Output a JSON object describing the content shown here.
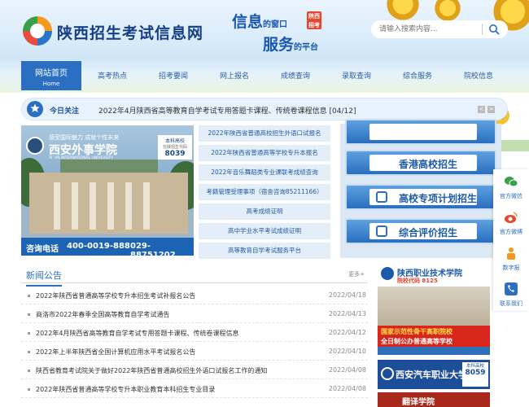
{
  "header": {
    "site_title": "陕西招生考试信息网",
    "slogan_line1": "信息",
    "slogan_line1_small": "的窗口",
    "slogan_line2": "服务",
    "slogan_line2_small": "的平台",
    "slogan_badge": "陕西招考",
    "search_placeholder": "请输入搜索内容..."
  },
  "nav": {
    "home_label": "网站首页",
    "home_sub": "Home",
    "items": [
      "高考热点",
      "招考要闻",
      "网上报名",
      "成绩查询",
      "录取查询",
      "综合服务",
      "院校信息"
    ]
  },
  "today": {
    "label": "今日关注",
    "headline": "2022年4月陕西省高等教育自学考试专用答题卡课程、传统卷课程信息  [04/12]",
    "prev": "<",
    "next": ">"
  },
  "banner": {
    "slogan": "感受国际魅力  成就个性未来",
    "school_name": "西安外事学院",
    "school_en": "XI' AN INTERNATIONAL UNIVERSITY",
    "code_label1": "本科高校",
    "code_label2": "在陕招生代码",
    "code": "8039",
    "phone_label": "咨询电话",
    "phone1": "400-0019-888",
    "phone2": "029-88751202"
  },
  "quick_links": [
    "2022年陕西省普通高校招生外语口试报名",
    "2022年陕西省普通高等学校专升本报名",
    "2022年音乐舞蹈类专业课联考成绩查询",
    "考籍管理受理事项（宿舍咨询85211166）",
    "高考成绩证明",
    "高中学业水平考试成绩证明",
    "高等教育自学考试服务平台"
  ],
  "feature_buttons": [
    "香港高校招生",
    "高校专项计划招生",
    "综合评价招生"
  ],
  "side_bar": [
    "官方微信",
    "官方微博",
    "数字报",
    "联系我们"
  ],
  "news": {
    "title": "新闻公告",
    "more": "更多+",
    "items": [
      {
        "title": "2022年陕西省普通高等学校专升本招生考试补报名公告",
        "date": "2022/04/18"
      },
      {
        "title": "商洛市2022年春季全国高等教育自学考试通告",
        "date": "2022/04/13"
      },
      {
        "title": "2022年4月陕西省高等教育自学考试专用答题卡课程、传统卷课程信息",
        "date": "2022/04/12"
      },
      {
        "title": "2022年上半年陕西省全国计算机应用水平考试报名公告",
        "date": "2022/04/10"
      },
      {
        "title": "陕西省教育考试院关于做好2022年陕西省普通高校招生外语口试报名工作的通知",
        "date": "2022/04/08"
      },
      {
        "title": "2022年陕西省普通高等学校专升本职业教育本科招生专业目录",
        "date": "2022/04/08"
      }
    ]
  },
  "ads": {
    "ad1_name": "陕西职业技术学院",
    "ad1_code": "院校代码  8125",
    "ad1_line1": "国家示范性骨干高职院校",
    "ad1_line2": "全日制公办普通高等学校",
    "ad2_name": "西安汽车职业大学",
    "ad2_code1": "本科高校",
    "ad2_code2": "8059",
    "ad3_name": "翻译学院"
  },
  "colors": {
    "primary": "#2b6fc3",
    "nav_text": "#2a5fa8",
    "title_blue": "#163e86",
    "banner_bar": "#1d63b4"
  }
}
